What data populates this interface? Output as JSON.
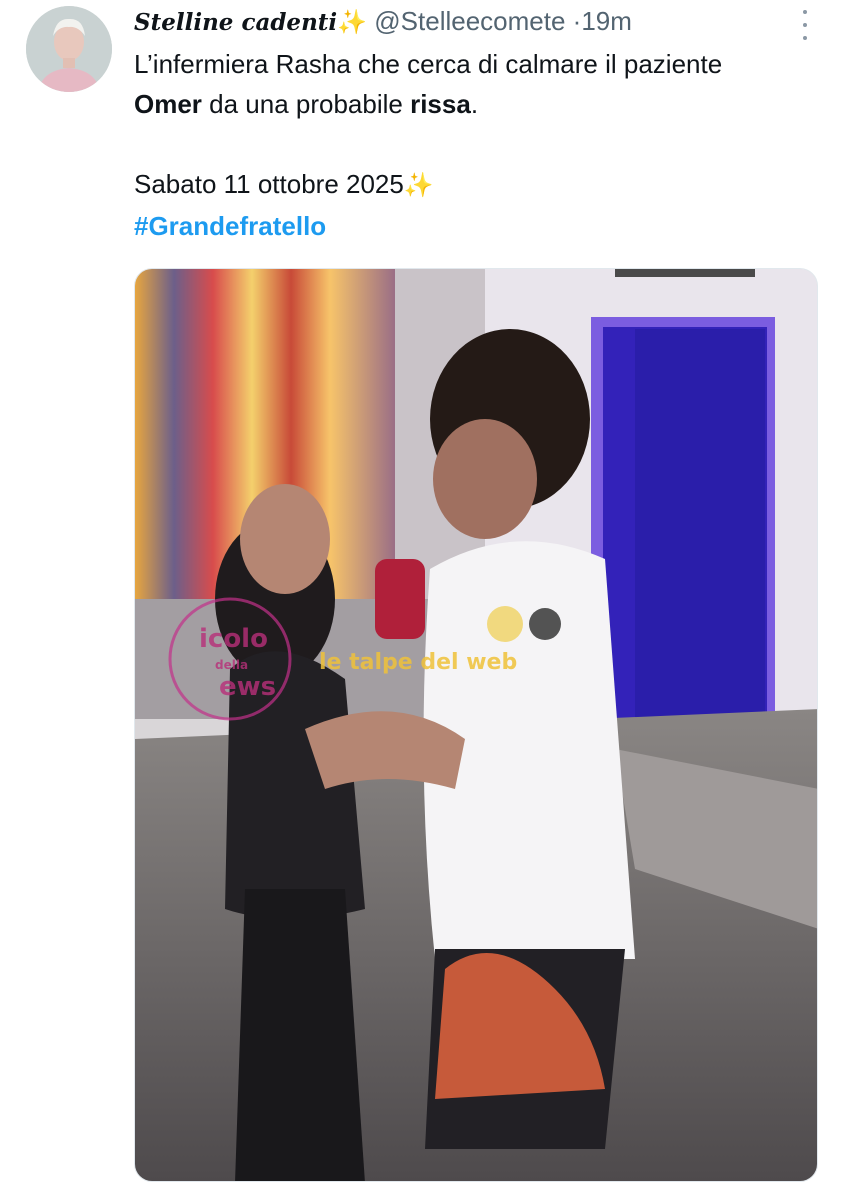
{
  "tweet": {
    "author": {
      "display_name": "Stelline cadenti",
      "display_emoji": "✨",
      "handle": "@Stelleecomete",
      "separator": "·",
      "time": "19m"
    },
    "text": {
      "line1_pre": "L’infermiera Rasha che cerca di calmare il paziente ",
      "name_bold": "Omer",
      "line1_mid": " da una probabile ",
      "word_bold": "rissa",
      "line1_end": ".",
      "date_line": "Sabato 11 ottobre 2025",
      "date_emoji": "✨",
      "hashtag": "#Grandefratello"
    },
    "media": {
      "watermark_left_line1": "icolo",
      "watermark_left_line2": "della",
      "watermark_left_line3": "ews",
      "watermark_right": "le talpe del web"
    },
    "icons": {
      "more": "more-vertical-icon",
      "sparkle": "sparkles-emoji"
    },
    "colors": {
      "hashtag": "#1d9bf0",
      "secondary_text": "#536471"
    }
  }
}
